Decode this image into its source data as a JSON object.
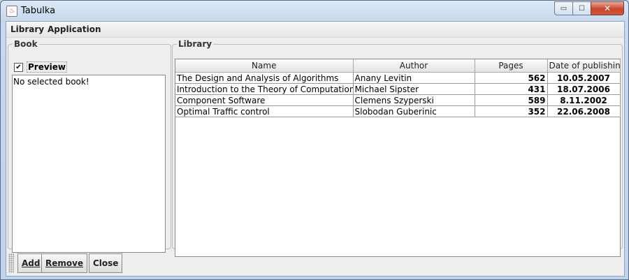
{
  "window": {
    "title": "Tabulka",
    "app_icon": "java-cup-icon",
    "minimize_glyph": "▭",
    "maximize_glyph": "☐",
    "close_glyph": "✕"
  },
  "menu": {
    "items": [
      "Library",
      "Application"
    ]
  },
  "book_panel": {
    "title": "Book",
    "preview_label": "Preview",
    "preview_checked": "✔",
    "text": "No selected book!"
  },
  "library_panel": {
    "title": "Library",
    "columns": [
      "Name",
      "Author",
      "Pages",
      "Date of publishing"
    ],
    "rows": [
      [
        "The Design and Analysis of Algorithms",
        "Anany Levitin",
        "562",
        "10.05.2007"
      ],
      [
        "Introduction to the Theory of Computation",
        "Michael Sipster",
        "431",
        "18.07.2006"
      ],
      [
        "Component Software",
        "Clemens Szyperski",
        "589",
        "8.11.2002"
      ],
      [
        "Optimal Traffic control",
        "Slobodan Guberinic",
        "352",
        "22.06.2008"
      ]
    ]
  },
  "buttons": {
    "add": "Add",
    "remove": "Remove",
    "close": "Close"
  }
}
